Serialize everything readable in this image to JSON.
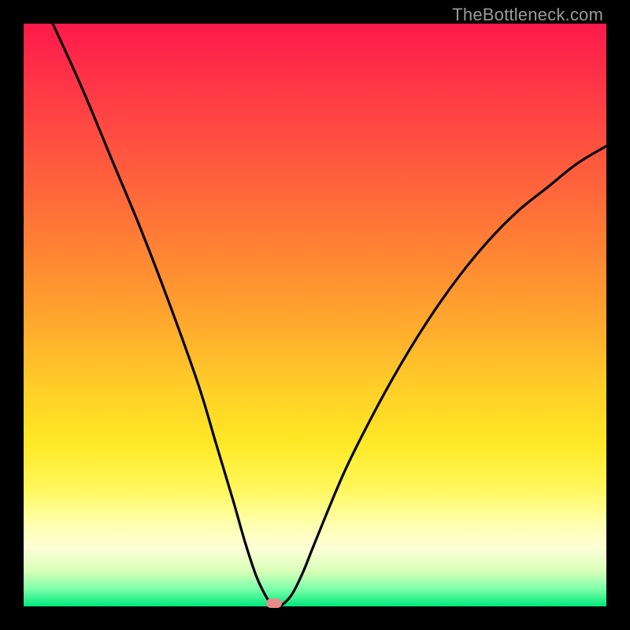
{
  "watermark": "TheBottleneck.com",
  "colors": {
    "frame": "#000000",
    "curve": "#000000",
    "marker": "#e88a8a",
    "gradient_stops": [
      "#ff1a4b",
      "#ff2f48",
      "#ff4a42",
      "#ff6a3a",
      "#ff8c32",
      "#ffae2d",
      "#ffd028",
      "#ffe825",
      "#fff85e",
      "#ffffb0",
      "#fdffd8",
      "#d8ffb8",
      "#7dffab",
      "#00e879"
    ]
  },
  "chart_data": {
    "type": "line",
    "title": "",
    "xlabel": "",
    "ylabel": "",
    "xlim": [
      0,
      100
    ],
    "ylim": [
      0,
      100
    ],
    "grid": false,
    "series": [
      {
        "name": "bottleneck-curve",
        "x": [
          5,
          10,
          15,
          20,
          25,
          30,
          33,
          36,
          38,
          40,
          42,
          43,
          44,
          46,
          48,
          50,
          55,
          60,
          65,
          70,
          75,
          80,
          85,
          90,
          95,
          100
        ],
        "values": [
          100,
          89,
          77,
          65,
          52,
          38,
          28,
          18,
          11,
          5,
          1,
          0,
          0,
          2,
          6,
          11,
          23,
          33,
          42,
          50,
          57,
          63,
          68,
          72,
          76,
          79
        ]
      }
    ],
    "annotations": [
      {
        "name": "min-marker",
        "x": 43,
        "y": 0
      }
    ]
  }
}
